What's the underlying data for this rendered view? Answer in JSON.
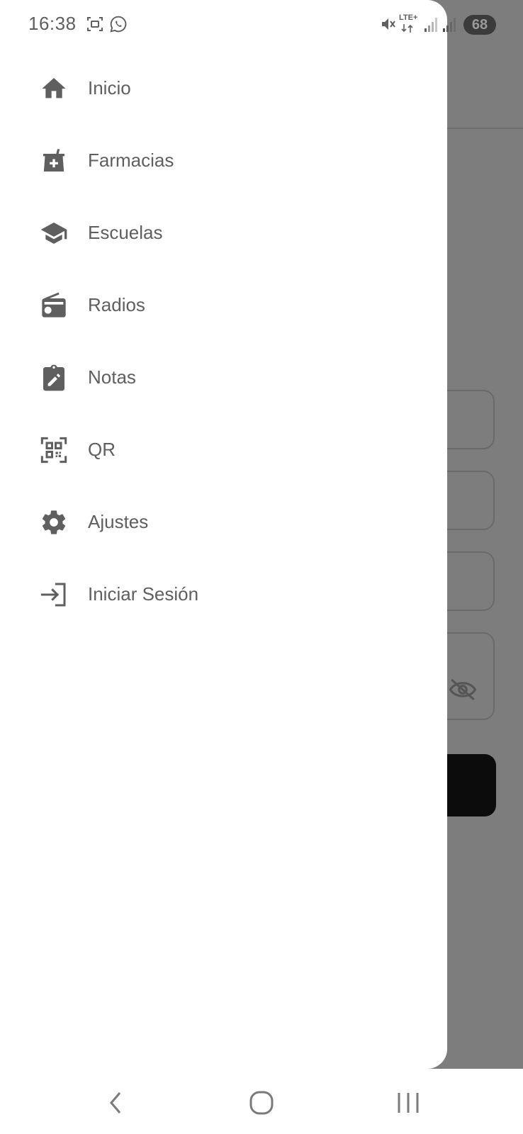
{
  "status_bar": {
    "time": "16:38",
    "network": "LTE+",
    "battery": "68",
    "icons": [
      "screenshot-icon",
      "whatsapp-icon",
      "mute-icon",
      "lte-icon",
      "signal-icon",
      "signal-icon",
      "battery-icon"
    ]
  },
  "drawer": {
    "items": [
      {
        "label": "Inicio",
        "icon": "home-icon"
      },
      {
        "label": "Farmacias",
        "icon": "pharmacy-icon"
      },
      {
        "label": "Escuelas",
        "icon": "school-icon"
      },
      {
        "label": "Radios",
        "icon": "radio-icon"
      },
      {
        "label": "Notas",
        "icon": "notes-icon"
      },
      {
        "label": "QR",
        "icon": "qr-icon"
      },
      {
        "label": "Ajustes",
        "icon": "settings-icon"
      },
      {
        "label": "Iniciar Sesión",
        "icon": "login-icon"
      }
    ]
  },
  "colors": {
    "scrim": "#7d7d7d",
    "drawer_bg": "#ffffff",
    "text": "#5f5f5f",
    "icon": "#5f5f5f",
    "background_button": "#0c0c0c"
  },
  "nav_bar": {
    "icons": [
      "back-icon",
      "home-nav-icon",
      "recents-icon"
    ]
  }
}
